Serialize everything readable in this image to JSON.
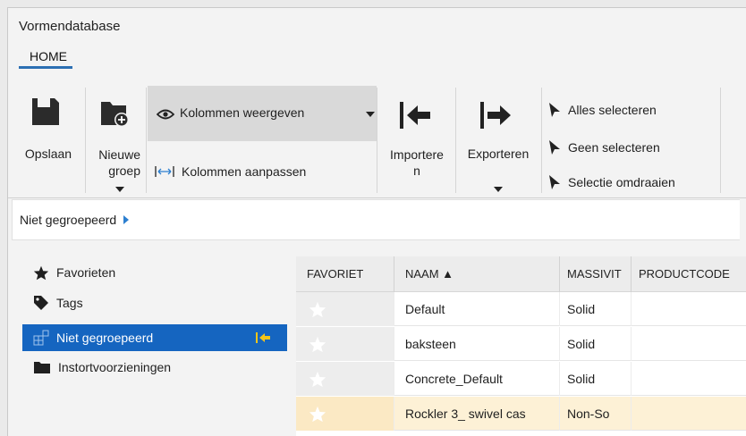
{
  "window": {
    "title": "Vormendatabase"
  },
  "tabs": [
    {
      "label": "HOME"
    }
  ],
  "ribbon": {
    "save": "Opslaan",
    "new_group": "Nieuwe groep",
    "show_columns": "Kolommen weergeven",
    "adjust_columns": "Kolommen aanpassen",
    "import": "Importeren",
    "export": "Exporteren",
    "select_all": "Alles selecteren",
    "select_none": "Geen selecteren",
    "invert_selection": "Selectie omdraaien"
  },
  "breadcrumb": {
    "text": "Niet gegroepeerd"
  },
  "sidebar": {
    "items": [
      {
        "label": "Favorieten",
        "icon": "star-icon"
      },
      {
        "label": "Tags",
        "icon": "tag-icon"
      },
      {
        "label": "Niet gegroepeerd",
        "icon": "ungrouped-icon",
        "selected": true
      },
      {
        "label": "Instortvoorzieningen",
        "icon": "folder-icon"
      }
    ]
  },
  "table": {
    "columns": [
      "FAVORIET",
      "NAAM ▲",
      "MASSIVIT",
      "PRODUCTCODE"
    ],
    "rows": [
      {
        "name": "Default",
        "massivity": "Solid"
      },
      {
        "name": "baksteen",
        "massivity": "Solid"
      },
      {
        "name": "Concrete_Default",
        "massivity": "Solid"
      },
      {
        "name": "Rockler 3_ swivel cas",
        "massivity": "Non-So"
      }
    ]
  },
  "colors": {
    "accent": "#1565c0",
    "selected_row": "#fdf1d6",
    "pin": "#f5c518"
  }
}
